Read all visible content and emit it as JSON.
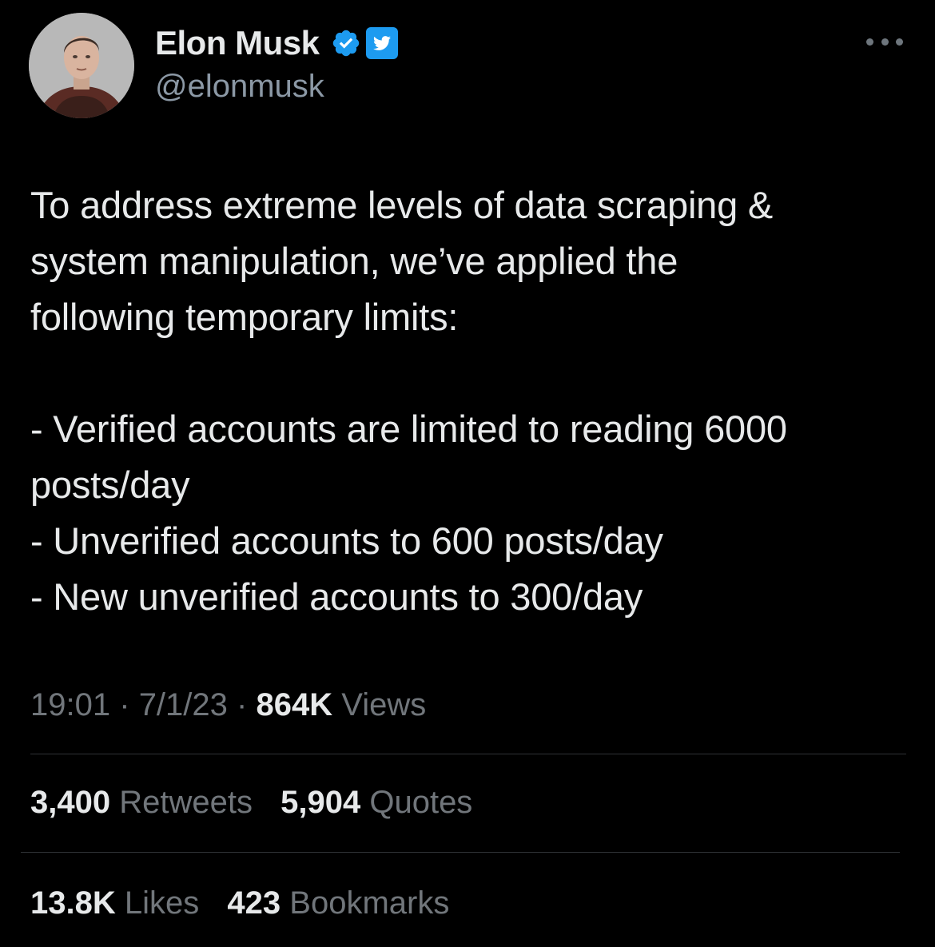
{
  "author": {
    "display_name": "Elon Musk",
    "handle": "@elonmusk",
    "verified_icon": "verified-badge-icon",
    "affiliate_icon": "twitter-bird-icon",
    "verified_color": "#1d9bf0"
  },
  "tweet": {
    "text_lines": [
      "To address extreme levels of data scraping &",
      "system manipulation, we’ve applied the",
      "following temporary limits:",
      "- Verified accounts are limited to reading 6000",
      "posts/day",
      "- Unverified accounts to 600 posts/day",
      "- New unverified accounts to 300/day"
    ]
  },
  "meta": {
    "time": "19:01",
    "date": "7/1/23",
    "views_count": "864K",
    "views_label": "Views",
    "separator": "·"
  },
  "stats": {
    "retweets_count": "3,400",
    "retweets_label": "Retweets",
    "quotes_count": "5,904",
    "quotes_label": "Quotes",
    "likes_count": "13.8K",
    "likes_label": "Likes",
    "bookmarks_count": "423",
    "bookmarks_label": "Bookmarks"
  },
  "colors": {
    "background": "#000000",
    "primary_text": "#e7e9ea",
    "secondary_text": "#71767b",
    "divider": "#2f3336"
  }
}
